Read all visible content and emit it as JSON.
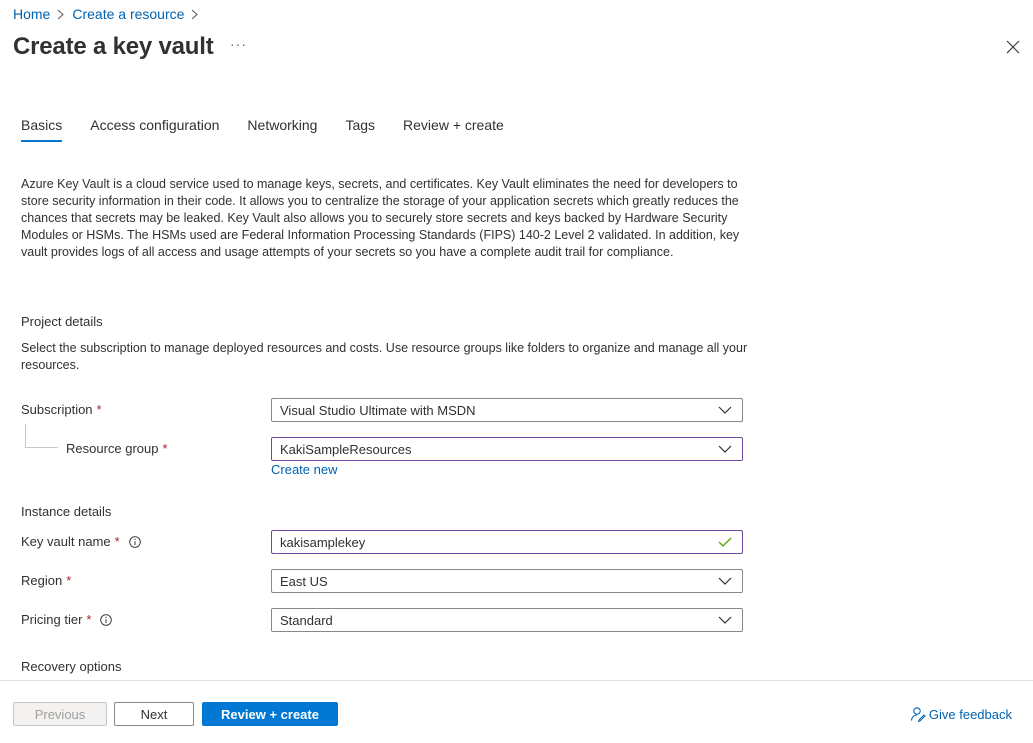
{
  "breadcrumb": {
    "home": "Home",
    "create_resource": "Create a resource"
  },
  "page": {
    "title": "Create a key vault",
    "more": "···"
  },
  "tabs": [
    {
      "label": "Basics"
    },
    {
      "label": "Access configuration"
    },
    {
      "label": "Networking"
    },
    {
      "label": "Tags"
    },
    {
      "label": "Review + create"
    }
  ],
  "intro": "Azure Key Vault is a cloud service used to manage keys, secrets, and certificates. Key Vault eliminates the need for developers to store security information in their code. It allows you to centralize the storage of your application secrets which greatly reduces the chances that secrets may be leaked. Key Vault also allows you to securely store secrets and keys backed by Hardware Security Modules or HSMs. The HSMs used are Federal Information Processing Standards (FIPS) 140-2 Level 2 validated. In addition, key vault provides logs of all access and usage attempts of your secrets so you have a complete audit trail for compliance.",
  "project": {
    "title": "Project details",
    "description": "Select the subscription to manage deployed resources and costs. Use resource groups like folders to organize and manage all your resources.",
    "subscription_label": "Subscription",
    "subscription_value": "Visual Studio Ultimate with MSDN",
    "resource_group_label": "Resource group",
    "resource_group_value": "KakiSampleResources",
    "create_new": "Create new"
  },
  "instance": {
    "title": "Instance details",
    "name_label": "Key vault name",
    "name_value": "kakisamplekey",
    "region_label": "Region",
    "region_value": "East US",
    "pricing_label": "Pricing tier",
    "pricing_value": "Standard"
  },
  "recovery": {
    "title": "Recovery options"
  },
  "required_mark": "*",
  "footer": {
    "previous": "Previous",
    "next": "Next",
    "review_create": "Review + create",
    "feedback": "Give feedback"
  },
  "colors": {
    "accent": "#0078d4",
    "link": "#0062b0",
    "required": "#a4262c",
    "focus_border": "#6e4a9e",
    "valid": "#57a300"
  }
}
